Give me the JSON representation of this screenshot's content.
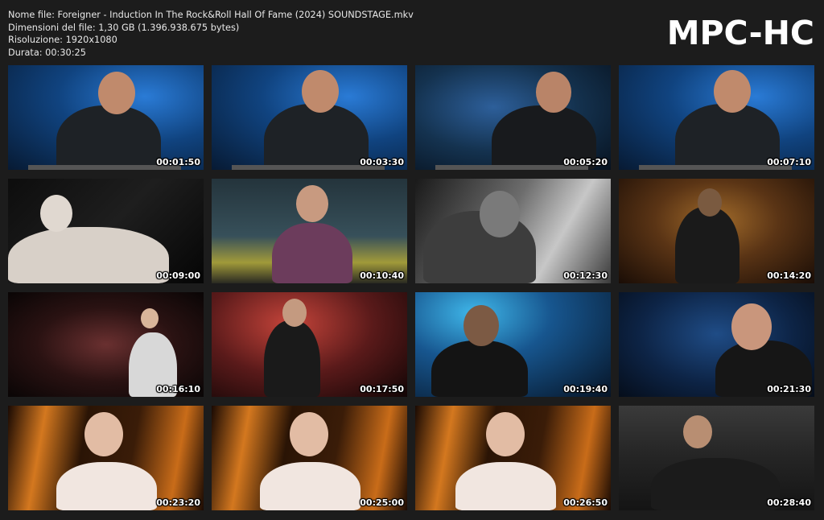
{
  "header": {
    "filename_line": "Nome file: Foreigner - Induction In The Rock&Roll Hall Of Fame (2024) SOUNDSTAGE.mkv",
    "size_line": "Dimensioni del file: 1,30 GB (1.396.938.675 bytes)",
    "resolution_line": "Risoluzione: 1920x1080",
    "duration_line": "Durata: 00:30:25"
  },
  "logo": "MPC-HC",
  "thumbnails": [
    {
      "time": "00:01:50",
      "scene": "s-blue"
    },
    {
      "time": "00:03:30",
      "scene": "s-blue"
    },
    {
      "time": "00:05:20",
      "scene": "s-blue2"
    },
    {
      "time": "00:07:10",
      "scene": "s-blue"
    },
    {
      "time": "00:09:00",
      "scene": "s-dark"
    },
    {
      "time": "00:10:40",
      "scene": "s-room"
    },
    {
      "time": "00:12:30",
      "scene": "s-bw"
    },
    {
      "time": "00:14:20",
      "scene": "s-stage"
    },
    {
      "time": "00:16:10",
      "scene": "s-stage2"
    },
    {
      "time": "00:17:50",
      "scene": "s-red"
    },
    {
      "time": "00:19:40",
      "scene": "s-spot"
    },
    {
      "time": "00:21:30",
      "scene": "s-spot2"
    },
    {
      "time": "00:23:20",
      "scene": "s-orange"
    },
    {
      "time": "00:25:00",
      "scene": "s-orange"
    },
    {
      "time": "00:26:50",
      "scene": "s-orange"
    },
    {
      "time": "00:28:40",
      "scene": "s-crowd"
    }
  ]
}
